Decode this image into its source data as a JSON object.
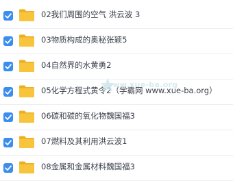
{
  "files": [
    {
      "name": "02我们周围的空气 洪云波 3",
      "checked": true,
      "icon": "folder-icon"
    },
    {
      "name": "03物质构成的奥秘张颖5",
      "checked": true,
      "icon": "folder-icon"
    },
    {
      "name": "04自然界的水黄勇2",
      "checked": true,
      "icon": "folder-icon"
    },
    {
      "name": "05化学方程式黄令2（学霸网 www.xue-ba.org）",
      "checked": true,
      "icon": "folder-icon"
    },
    {
      "name": "06碳和碳的氧化物魏国福3",
      "checked": true,
      "icon": "folder-icon"
    },
    {
      "name": "07燃料及其利用洪云波1",
      "checked": true,
      "icon": "folder-icon"
    },
    {
      "name": "08金属和金属材料魏国福3",
      "checked": true,
      "icon": "folder-icon"
    }
  ],
  "watermark": {
    "text": "www.xue-ba.org",
    "icon": "watermark-logo"
  },
  "colors": {
    "checkbox": "#3b8df0",
    "folder": "#f7c43c",
    "folder_tab": "#eeae1f",
    "text": "#3a3f4a",
    "divider": "#eceef2"
  }
}
